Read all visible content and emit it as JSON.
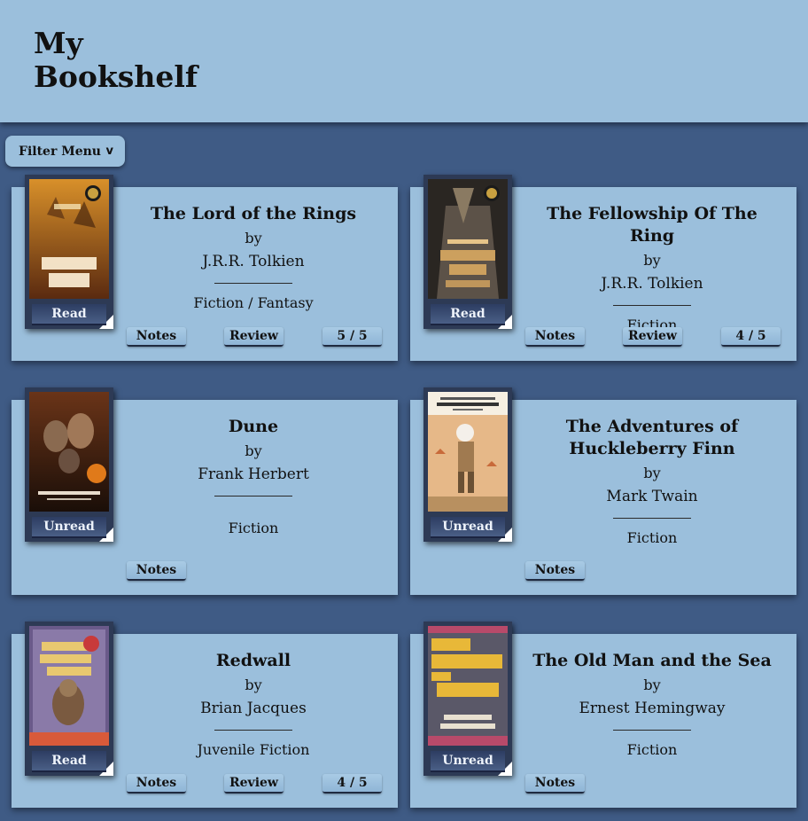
{
  "header": {
    "title": "My Bookshelf"
  },
  "filter": {
    "label": "Filter Menu",
    "chevron": "v"
  },
  "books": [
    {
      "title": "The Lord of the Rings",
      "by": "by",
      "author": "J.R.R. Tolkien",
      "genre": "Fiction / Fantasy",
      "status": "Read",
      "notes_label": "Notes",
      "review_label": "Review",
      "rating": "5 / 5"
    },
    {
      "title": "The Fellowship Of The Ring",
      "by": "by",
      "author": "J.R.R. Tolkien",
      "genre": "Fiction",
      "status": "Read",
      "notes_label": "Notes",
      "review_label": "Review",
      "rating": "4 / 5"
    },
    {
      "title": "Dune",
      "by": "by",
      "author": "Frank Herbert",
      "genre": "Fiction",
      "status": "Unread",
      "notes_label": "Notes"
    },
    {
      "title": "The Adventures of Huckleberry Finn",
      "by": "by",
      "author": "Mark Twain",
      "genre": "Fiction",
      "status": "Unread",
      "notes_label": "Notes"
    },
    {
      "title": "Redwall",
      "by": "by",
      "author": "Brian Jacques",
      "genre": "Juvenile Fiction",
      "status": "Read",
      "notes_label": "Notes",
      "review_label": "Review",
      "rating": "4 / 5"
    },
    {
      "title": "The Old Man and the Sea",
      "by": "by",
      "author": "Ernest Hemingway",
      "genre": "Fiction",
      "status": "Unread",
      "notes_label": "Notes"
    }
  ],
  "colors": {
    "background": "#3f5b85",
    "panel": "#9bbfdc",
    "status_button": "#2d3d62"
  }
}
